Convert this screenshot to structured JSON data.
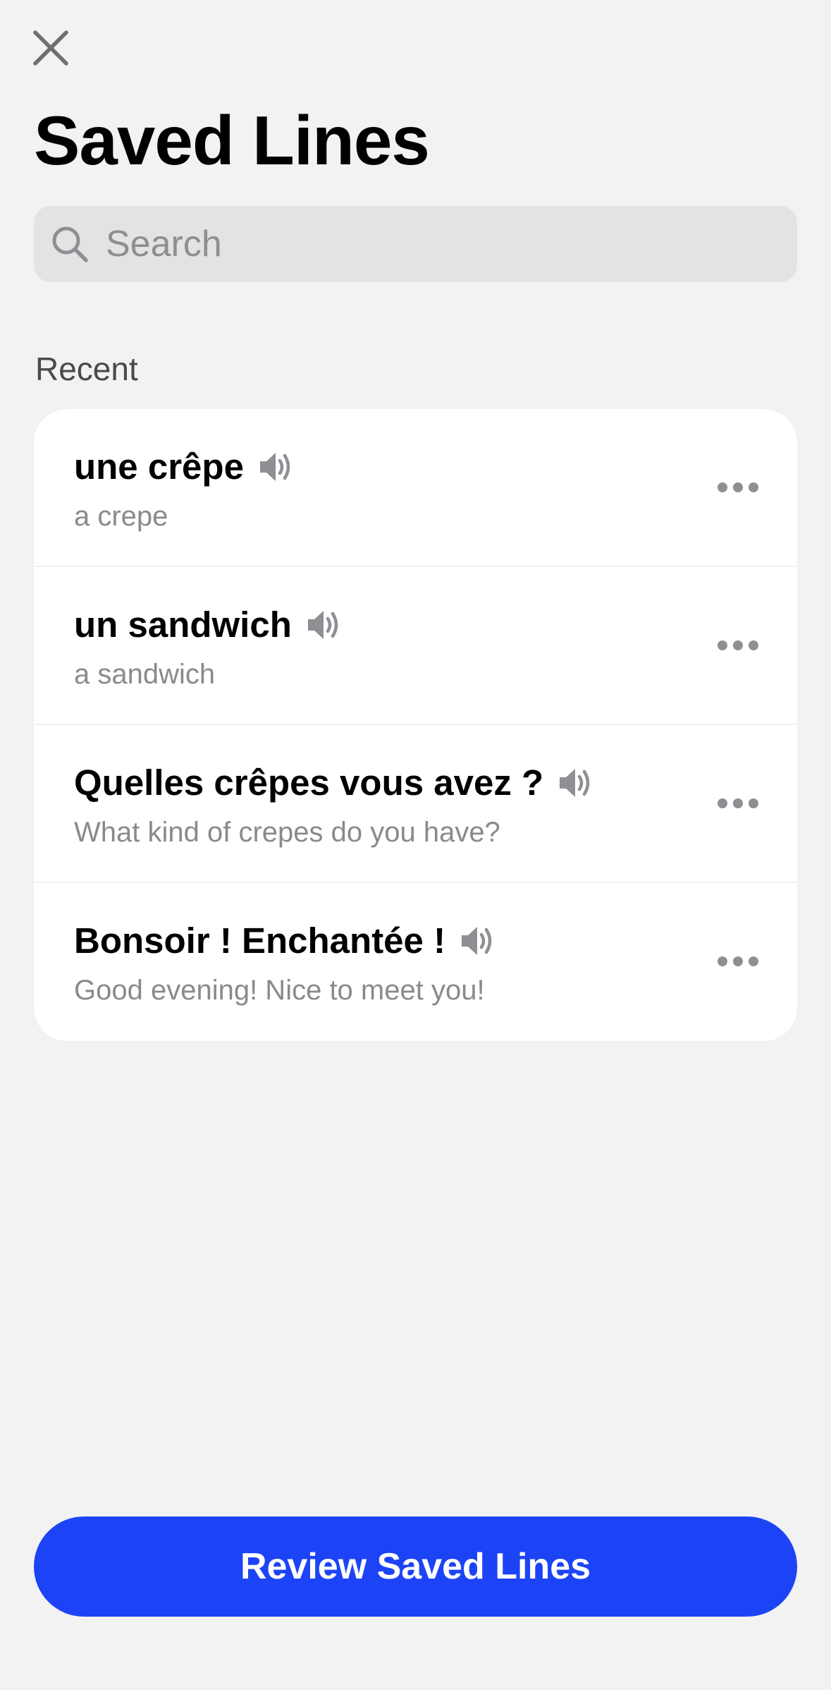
{
  "header": {
    "title": "Saved Lines"
  },
  "search": {
    "placeholder": "Search",
    "value": ""
  },
  "section": {
    "label": "Recent"
  },
  "items": [
    {
      "phrase": "une crêpe",
      "translation": "a crepe"
    },
    {
      "phrase": "un sandwich",
      "translation": "a sandwich"
    },
    {
      "phrase": "Quelles crêpes vous avez ?",
      "translation": "What kind of crepes do you have?"
    },
    {
      "phrase": "Bonsoir ! Enchantée !",
      "translation": "Good evening! Nice to meet you!"
    }
  ],
  "footer": {
    "review_label": "Review Saved Lines"
  },
  "icons": {
    "close": "close-icon",
    "search": "search-icon",
    "speaker": "speaker-icon",
    "more": "more-icon"
  },
  "colors": {
    "accent": "#1c44f6",
    "background": "#f2f2f3",
    "card": "#ffffff",
    "secondary_text": "#8a8a8e",
    "icon_gray": "#8e8e93"
  }
}
